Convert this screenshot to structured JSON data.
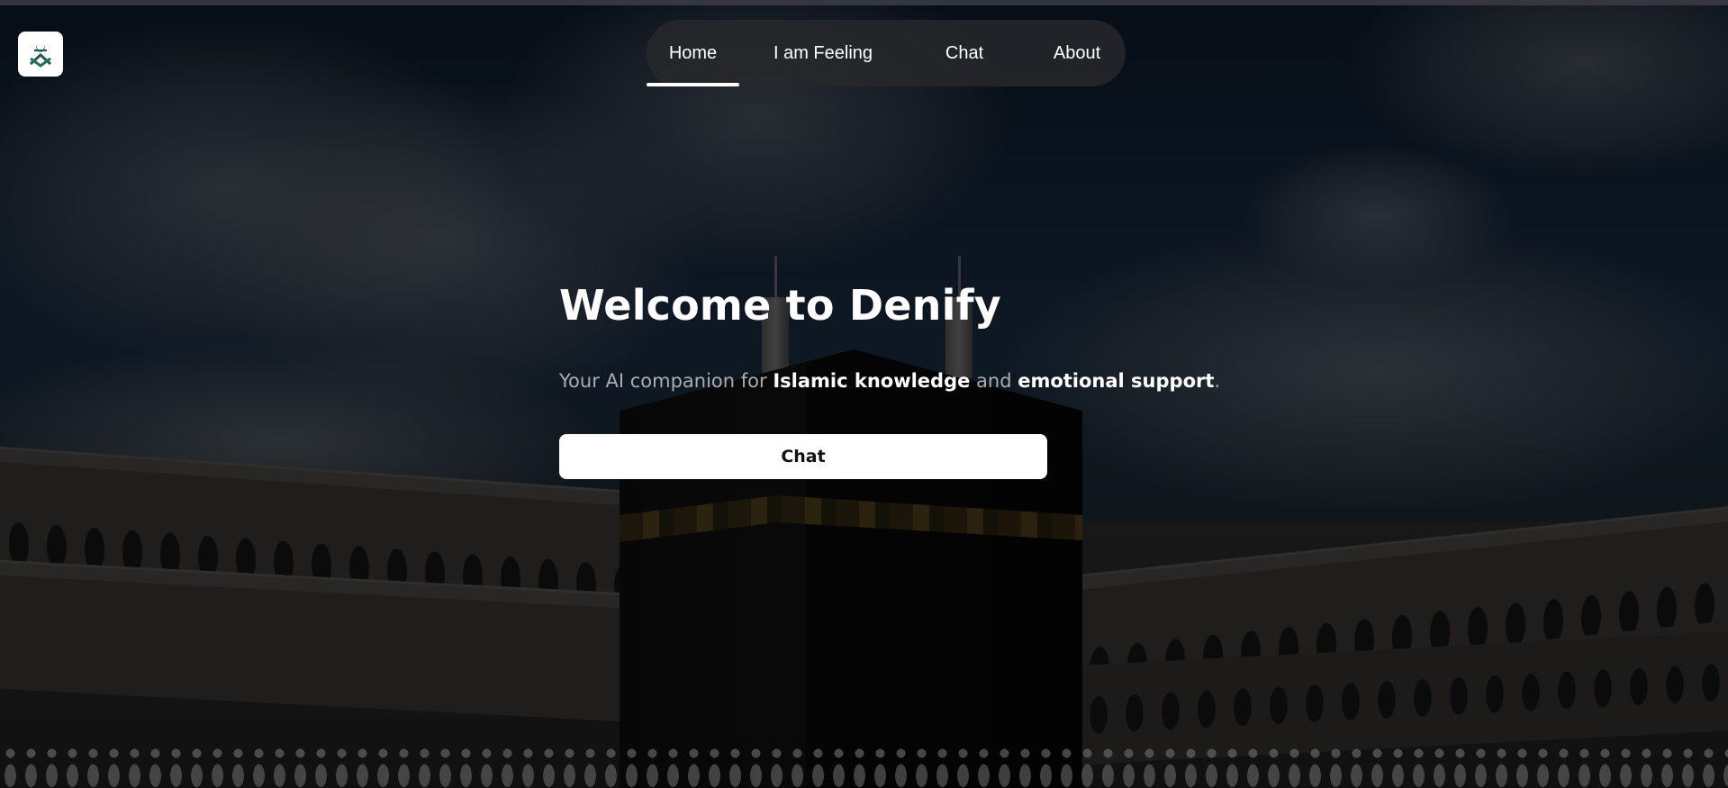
{
  "nav": {
    "items": [
      {
        "label": "Home",
        "active": true
      },
      {
        "label": "I am Feeling",
        "active": false
      },
      {
        "label": "Chat",
        "active": false
      },
      {
        "label": "About",
        "active": false
      }
    ]
  },
  "logo": {
    "icon": "crescent-book-icon"
  },
  "hero": {
    "title": "Welcome to Denify",
    "subtitle_prefix": "Your AI companion for ",
    "subtitle_strong_1": "Islamic knowledge",
    "subtitle_middle": " and ",
    "subtitle_strong_2": "emotional support",
    "subtitle_suffix": ".",
    "button_label": "Chat"
  },
  "colors": {
    "nav_background": "#28282c",
    "text_primary": "#ffffff",
    "text_muted": "#a9adb3",
    "button_background": "#ffffff",
    "button_text": "#111111",
    "logo_accent": "#1f5a4a"
  }
}
